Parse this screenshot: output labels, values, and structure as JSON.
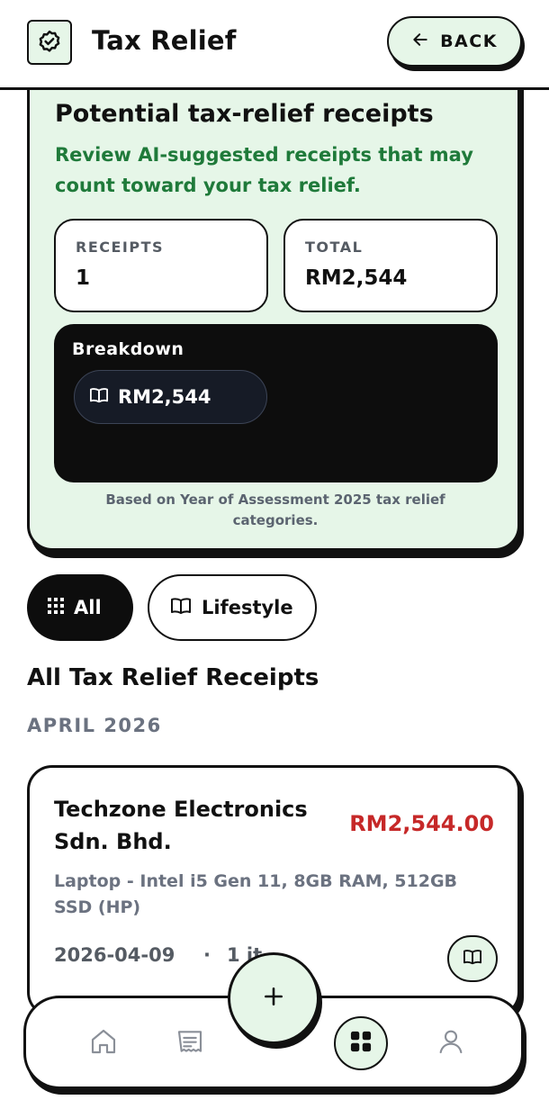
{
  "header": {
    "title": "Tax Relief",
    "back_label": "BACK"
  },
  "summary": {
    "title": "Potential tax-relief receipts",
    "description": "Review AI-suggested receipts that may count toward your tax relief.",
    "receipts_label": "RECEIPTS",
    "receipts_value": "1",
    "total_label": "TOTAL",
    "total_value": "RM2,544",
    "breakdown_title": "Breakdown",
    "breakdown_items": [
      {
        "icon": "book-icon",
        "value": "RM2,544"
      }
    ],
    "footnote": "Based on Year of Assessment 2025 tax relief categories."
  },
  "filters": [
    {
      "icon": "grid-icon",
      "label": "All",
      "selected": true
    },
    {
      "icon": "book-icon",
      "label": "Lifestyle",
      "selected": false
    }
  ],
  "list": {
    "section_title": "All Tax Relief Receipts",
    "month_label": "APRIL 2026",
    "receipts": [
      {
        "merchant": "Techzone Electronics Sdn. Bhd.",
        "amount": "RM2,544.00",
        "description": "Laptop - Intel i5 Gen 11, 8GB RAM, 512GB SSD (HP)",
        "date": "2026-04-09",
        "separator": "·",
        "items": "1 it",
        "category_icon": "book-icon"
      }
    ]
  },
  "bottom_nav": {
    "items": [
      "home-icon",
      "receipt-icon",
      "grid-icon",
      "user-icon"
    ],
    "active": "grid-icon",
    "fab_icon": "plus-icon"
  },
  "colors": {
    "accent_bg": "#e6f6e8",
    "accent_text": "#1f7a3a",
    "amount_red": "#c62828",
    "dark": "#0d0d0d"
  }
}
